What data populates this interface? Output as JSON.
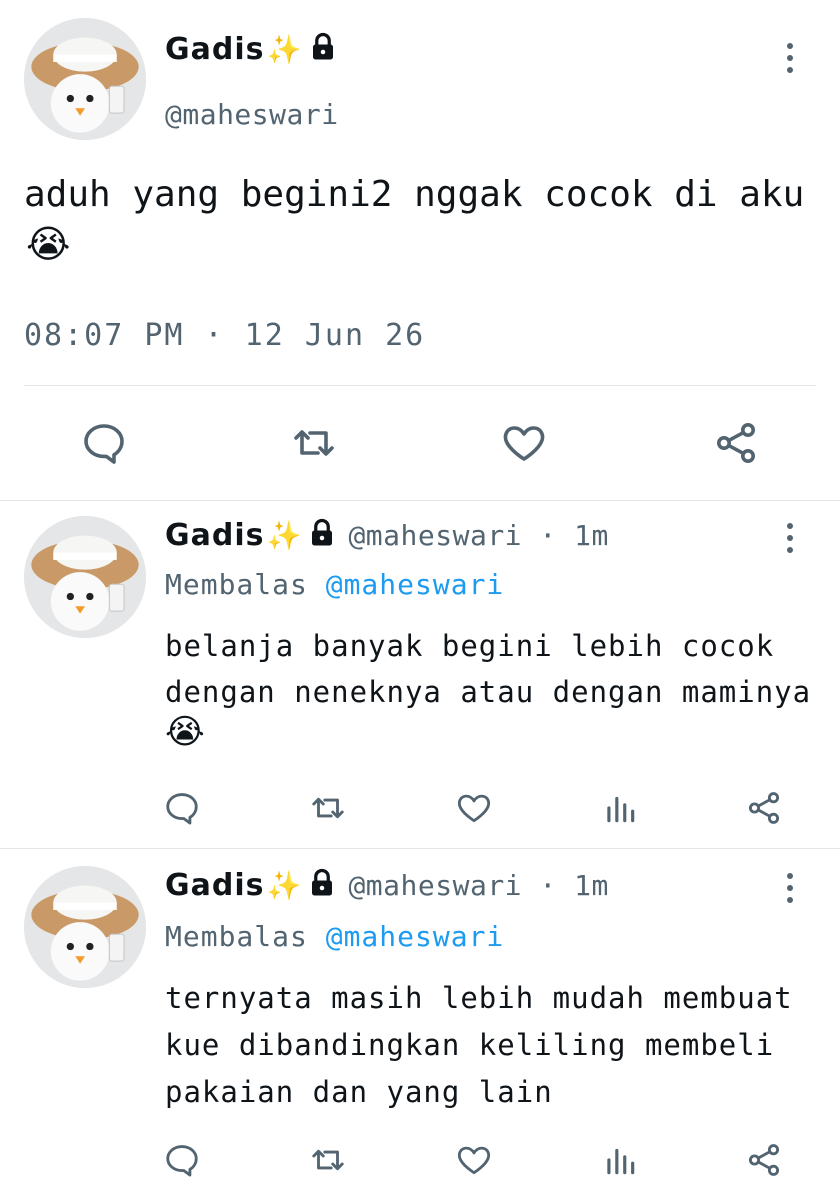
{
  "main_tweet": {
    "display_name": "Gadis",
    "name_emoji": "✨",
    "handle": "@maheswari",
    "text_line1": "aduh yang begini2 nggak cocok di aku",
    "text_emoji": "😭",
    "timestamp": "08:07 PM · 12 Jun 26"
  },
  "replies": [
    {
      "display_name": "Gadis",
      "name_emoji": "✨",
      "handle": "@maheswari",
      "age": "1m",
      "replying_prefix": "Membalas ",
      "replying_to": "@maheswari",
      "lines": [
        "belanja banyak begini lebih cocok",
        "dengan neneknya atau dengan maminya"
      ],
      "emoji": "😭"
    },
    {
      "display_name": "Gadis",
      "name_emoji": "✨",
      "handle": "@maheswari",
      "age": "1m",
      "replying_prefix": "Membalas ",
      "replying_to": "@maheswari",
      "lines": [
        "ternyata masih lebih mudah membuat",
        "kue dibandingkan keliling membeli",
        "pakaian dan yang lain"
      ],
      "emoji": ""
    }
  ],
  "separator": " · ",
  "icons": {
    "reply": "reply-icon",
    "retweet": "retweet-icon",
    "like": "like-icon",
    "views": "views-icon",
    "share": "share-icon",
    "more": "more-icon",
    "lock": "lock-icon"
  },
  "colors": {
    "text": "#0f1419",
    "secondary": "#536471",
    "accent": "#1d9bf0",
    "divider": "#e1e6ea"
  }
}
